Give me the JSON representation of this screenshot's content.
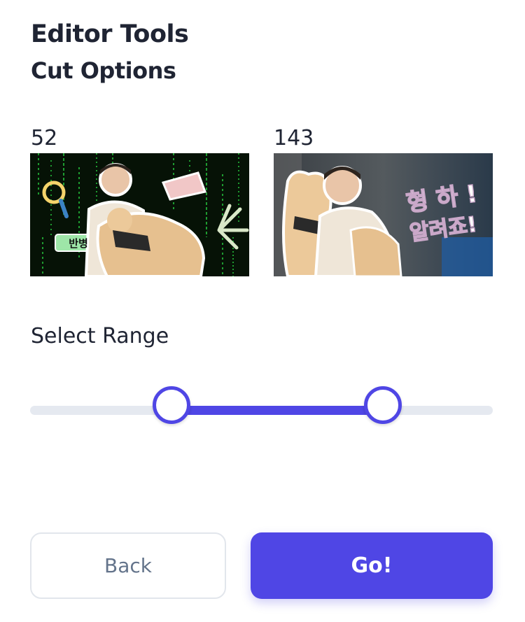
{
  "header": {
    "title": "Editor Tools",
    "subtitle": "Cut Options"
  },
  "frames": {
    "start": {
      "number": "52",
      "thumbnail_text": "반병"
    },
    "end": {
      "number": "143",
      "thumbnail_text_line1": "형 하 !",
      "thumbnail_text_line2": "알려죠!"
    }
  },
  "range": {
    "label": "Select Range",
    "start_fraction": 0.3,
    "end_fraction": 0.757
  },
  "buttons": {
    "back_label": "Back",
    "go_label": "Go!"
  },
  "colors": {
    "accent": "#4f46e5",
    "track": "#e5e9f0"
  }
}
